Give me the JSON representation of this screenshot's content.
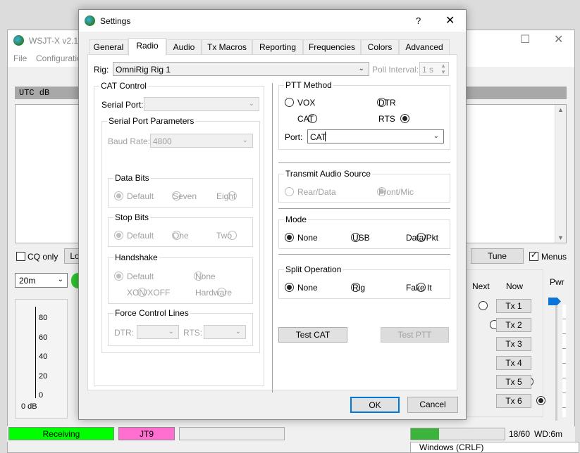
{
  "main": {
    "title": "WSJT-X   v2.1.",
    "menu": [
      "File",
      "Configuration"
    ],
    "utc_header": "UTC    dB",
    "cq_only": "CQ only",
    "log_btn": "Lo",
    "band": "20m",
    "tune": "Tune",
    "menus": "Menus",
    "next": "Next",
    "now": "Now",
    "pwr": "Pwr",
    "tx_buttons": [
      "Tx 1",
      "Tx 2",
      "Tx 3",
      "Tx 4",
      "Tx 5",
      "Tx 6"
    ],
    "meter_ticks": [
      "80",
      "60",
      "40",
      "20",
      "0"
    ],
    "meter_unit": "0 dB",
    "status": {
      "receiving": "Receiving",
      "mode": "JT9",
      "progress": "18/60",
      "wd": "WD:6m",
      "eol": "Windows (CRLF)"
    },
    "colors": {
      "receiving": "#00ff00",
      "mode": "#ff6fd0"
    }
  },
  "dialog": {
    "title": "Settings",
    "help": "?",
    "close": "✕",
    "tabs": [
      "General",
      "Radio",
      "Audio",
      "Tx Macros",
      "Reporting",
      "Frequencies",
      "Colors",
      "Advanced"
    ],
    "active_tab": "Radio",
    "rig_label": "Rig:",
    "rig_value": "OmniRig Rig 1",
    "poll_label": "Poll Interval:",
    "poll_value": "1 s",
    "cat_control": {
      "title": "CAT Control",
      "serial_port_label": "Serial Port:",
      "serial_params_title": "Serial Port Parameters",
      "baud_label": "Baud Rate:",
      "baud_value": "4800",
      "data_bits": {
        "title": "Data Bits",
        "options": [
          "Default",
          "Seven",
          "Eight"
        ]
      },
      "stop_bits": {
        "title": "Stop Bits",
        "options": [
          "Default",
          "One",
          "Two"
        ]
      },
      "handshake": {
        "title": "Handshake",
        "options": [
          "Default",
          "None",
          "XON/XOFF",
          "Hardware"
        ]
      },
      "force_lines": {
        "title": "Force Control Lines",
        "dtr": "DTR:",
        "rts": "RTS:"
      }
    },
    "ptt": {
      "title": "PTT Method",
      "options": [
        "VOX",
        "DTR",
        "CAT",
        "RTS"
      ],
      "selected": "RTS",
      "port_label": "Port:",
      "port_value": "CAT"
    },
    "audio_source": {
      "title": "Transmit Audio Source",
      "options": [
        "Rear/Data",
        "Front/Mic"
      ],
      "selected": "Front/Mic"
    },
    "mode": {
      "title": "Mode",
      "options": [
        "None",
        "USB",
        "Data/Pkt"
      ],
      "selected": "None"
    },
    "split": {
      "title": "Split Operation",
      "options": [
        "None",
        "Rig",
        "Fake It"
      ],
      "selected": "None"
    },
    "test_cat": "Test CAT",
    "test_ptt": "Test PTT",
    "ok": "OK",
    "cancel": "Cancel"
  }
}
